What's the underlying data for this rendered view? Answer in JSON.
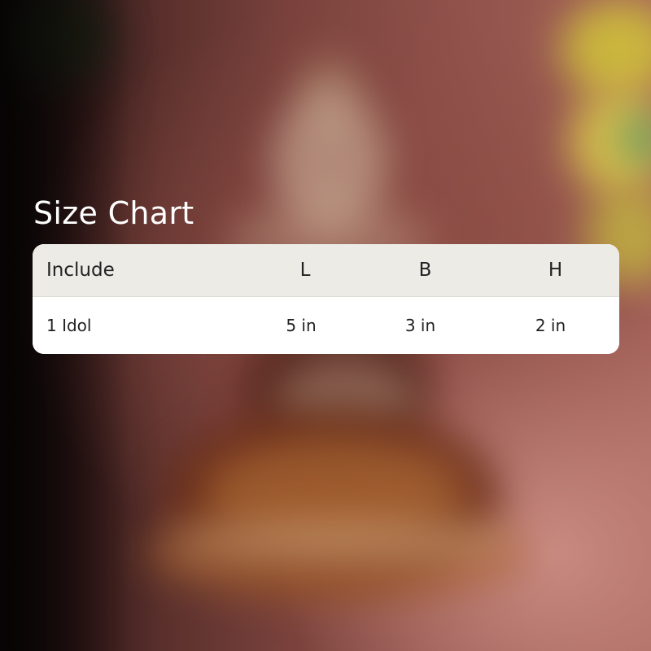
{
  "title": "Size Chart",
  "table": {
    "headers": [
      "Include",
      "L",
      "B",
      "H"
    ],
    "rows": [
      [
        "1 Idol",
        "5 in",
        "3 in",
        "2 in"
      ]
    ]
  },
  "colors": {
    "header_bg": "#ecebe6",
    "body_bg": "#ffffff",
    "text": "#222222",
    "title": "#ffffff"
  }
}
